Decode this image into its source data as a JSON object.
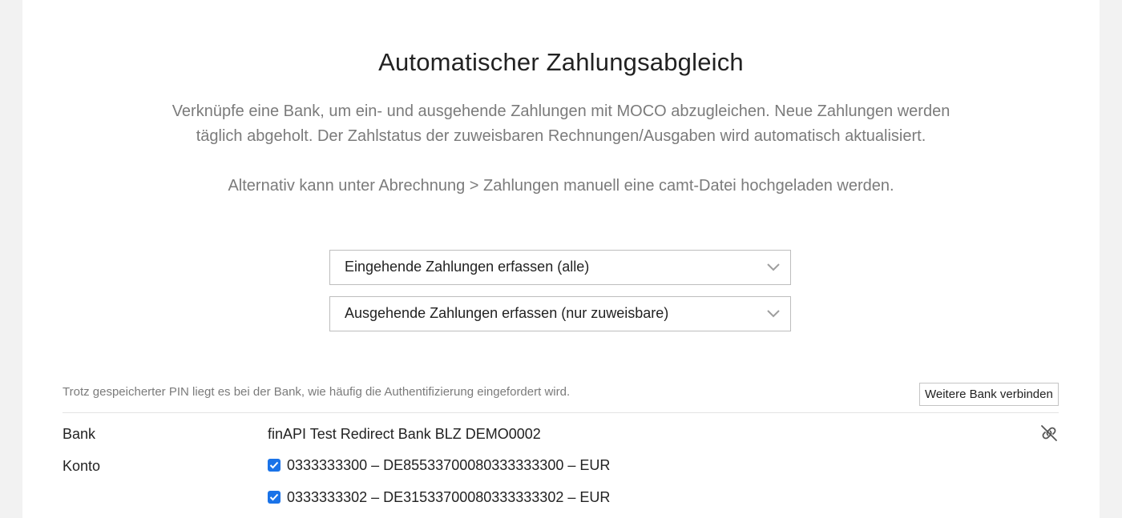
{
  "header": {
    "title": "Automatischer Zahlungsabgleich"
  },
  "description": {
    "line1": "Verknüpfe eine Bank, um ein- und ausgehende Zahlungen mit MOCO abzugleichen. Neue Zahlungen werden",
    "line2": "täglich abgeholt. Der Zahlstatus der zuweisbaren Rechnungen/Ausgaben wird automatisch aktualisiert.",
    "alternative": "Alternativ kann unter Abrechnung > Zahlungen manuell eine camt-Datei hochgeladen werden."
  },
  "selects": {
    "incoming": "Eingehende Zahlungen erfassen (alle)",
    "outgoing": "Ausgehende Zahlungen erfassen (nur zuweisbare)"
  },
  "pin_note": "Trotz gespeicherter PIN liegt es bei der Bank, wie häufig die Authentifizierung eingefordert wird.",
  "connect_button": "Weitere Bank verbinden",
  "bank_section": {
    "bank_label": "Bank",
    "bank_name": "finAPI Test Redirect Bank BLZ DEMO0002",
    "account_label": "Konto",
    "accounts": [
      {
        "text": "0333333300 – DE85533700080333333300 – EUR",
        "checked": true
      },
      {
        "text": "0333333302 – DE31533700080333333302 – EUR",
        "checked": true
      }
    ],
    "unlink_icon": "unlink-icon"
  },
  "colors": {
    "checkbox": "#1a73e8",
    "muted_text": "#7b7b7b",
    "background": "#f2f2f2"
  }
}
